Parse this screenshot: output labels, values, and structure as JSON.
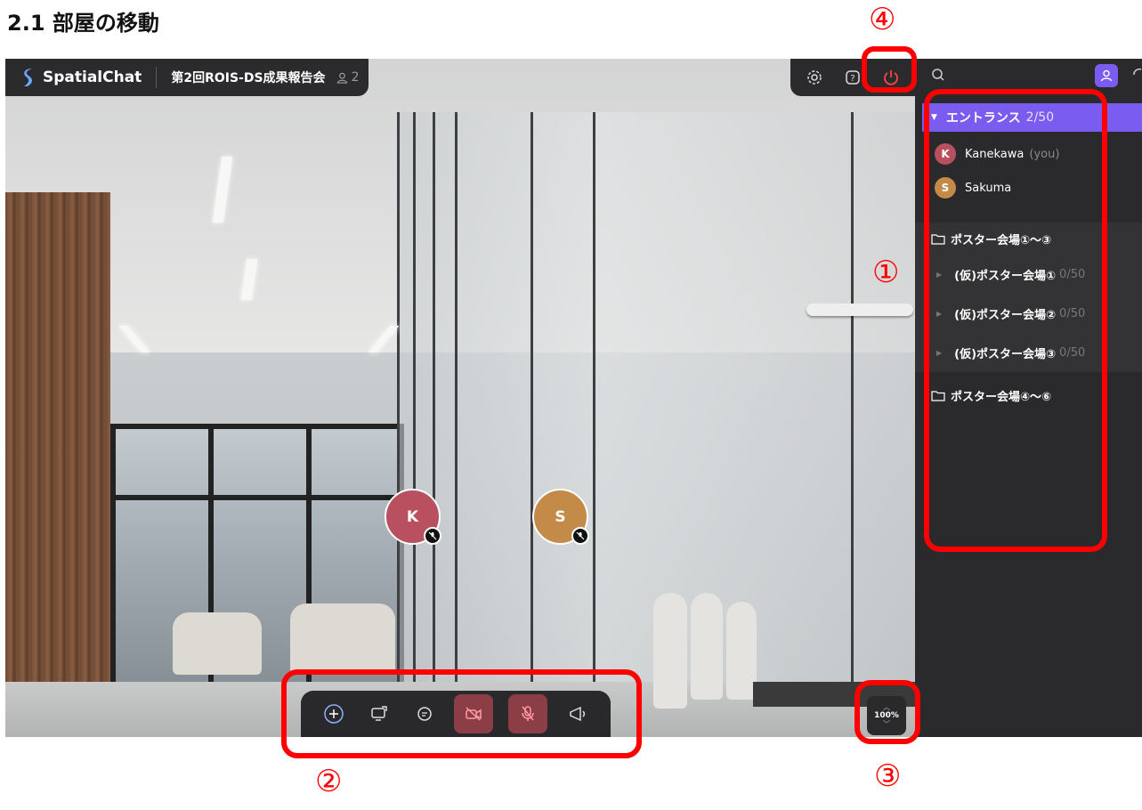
{
  "heading": "2.1 部屋の移動",
  "topbar": {
    "brand": "SpatialChat",
    "room_name": "第2回ROIS-DS成果報告会",
    "user_count": "2"
  },
  "sidebar": {
    "current_room": {
      "name": "エントランス",
      "capacity": "2/50"
    },
    "members": [
      {
        "initial": "K",
        "name": "Kanekawa",
        "tag": "(you)",
        "color": "#b8505f"
      },
      {
        "initial": "S",
        "name": "Sakuma",
        "tag": "",
        "color": "#c48a48"
      }
    ],
    "folders": [
      {
        "name": "ポスター会場①〜③",
        "rooms": [
          {
            "name": "(仮)ポスター会場①",
            "capacity": "0/50"
          },
          {
            "name": "(仮)ポスター会場②",
            "capacity": "0/50"
          },
          {
            "name": "(仮)ポスター会場③",
            "capacity": "0/50"
          }
        ]
      },
      {
        "name": "ポスター会場④〜⑥",
        "rooms": []
      }
    ]
  },
  "avatars": [
    {
      "initial": "K",
      "color": "#b8505f"
    },
    {
      "initial": "S",
      "color": "#c48a48"
    }
  ],
  "zoom": "100%",
  "annotations": [
    "①",
    "②",
    "③",
    "④"
  ],
  "colors": {
    "accent": "#7b5cf0",
    "annotation": "#ff0000",
    "muted_button": "#8c3e47"
  }
}
